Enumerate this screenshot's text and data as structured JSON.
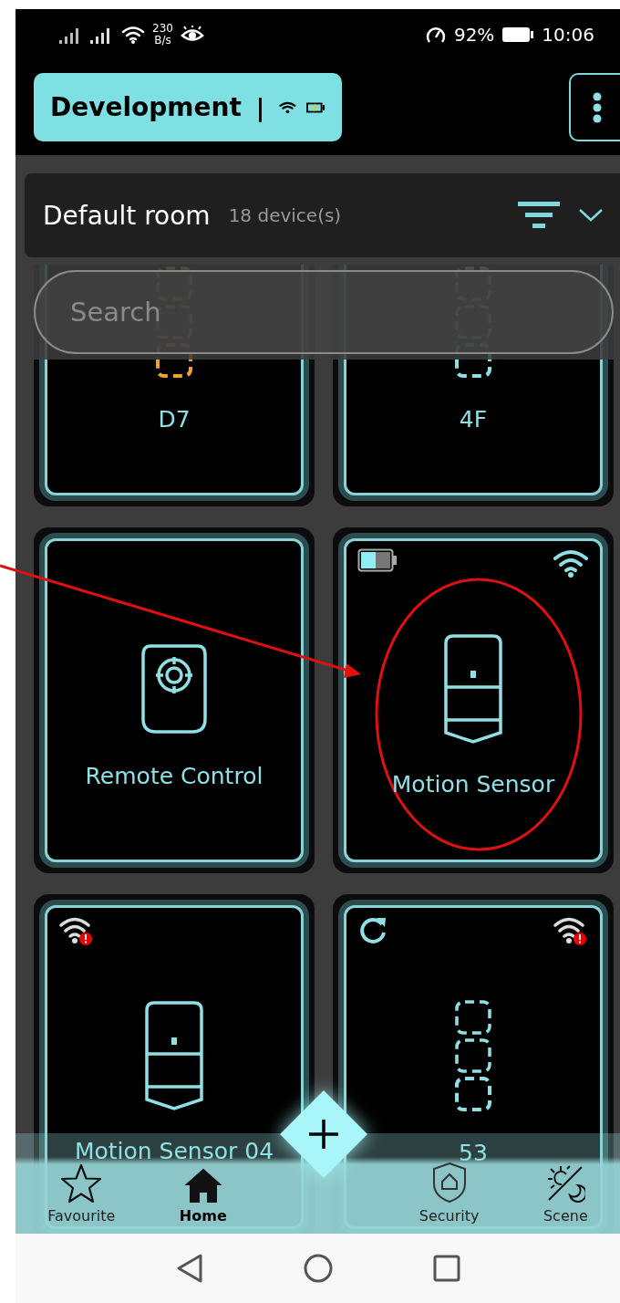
{
  "status_bar": {
    "speed": "230",
    "speed_unit": "B/s",
    "battery": "92%",
    "time": "10:06"
  },
  "header": {
    "title": "Development",
    "separator": "|"
  },
  "room": {
    "name": "Default room",
    "count": "18 device(s)"
  },
  "search": {
    "placeholder": "Search"
  },
  "devices": [
    {
      "name": "D7",
      "kind": "generic",
      "color": "#f0a030"
    },
    {
      "name": "4F",
      "kind": "generic",
      "color": "#8ee0e4"
    },
    {
      "name": "Remote Control",
      "kind": "remote",
      "color": "#8ee0e4"
    },
    {
      "name": "Motion Sensor",
      "kind": "motion",
      "color": "#8ee0e4",
      "top_left": {
        "kind": "battery",
        "level": 0.5
      },
      "top_right": {
        "kind": "wifi"
      }
    },
    {
      "name": "Motion Sensor 04",
      "kind": "motion",
      "color": "#8ee0e4",
      "top_left": {
        "kind": "wifi_error"
      }
    },
    {
      "name": "53",
      "kind": "generic",
      "color": "#8ee0e4",
      "top_left": {
        "kind": "refresh"
      },
      "top_right": {
        "kind": "wifi_error"
      }
    }
  ],
  "nav": [
    {
      "label": "Favourite",
      "kind": "star",
      "selected": false
    },
    {
      "label": "Home",
      "kind": "home",
      "selected": true
    },
    {
      "label": "Security",
      "kind": "shield",
      "selected": false
    },
    {
      "label": "Scene",
      "kind": "scene",
      "selected": false
    }
  ]
}
